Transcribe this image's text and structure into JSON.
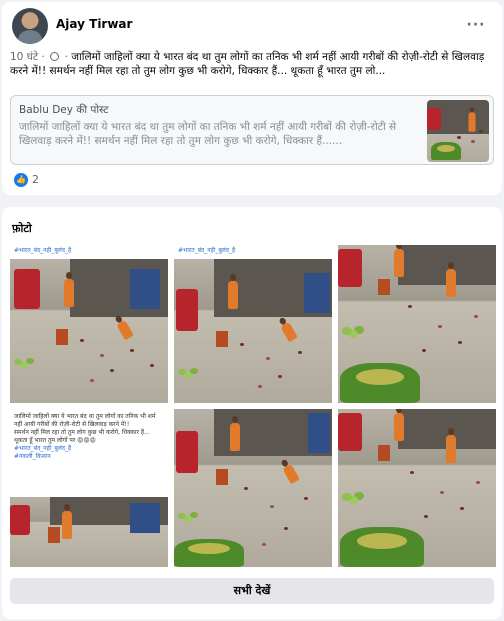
{
  "post": {
    "author": "Ajay Tirwar",
    "more_icon": "more-horizontal-icon",
    "time": "10 घंटे",
    "separator": " · ",
    "text": "जालिमों जाहिलों क्या ये भारत बंद था तुम लोगों का तनिक भी शर्म नहीं आयी गरीबों की रोज़ी-रोटी से खिलवाड़ करने में!! समर्थन नहीं मिल रहा तो तुम लोग कुछ भी करोगे, धिक्कार हैं... थूकता हूँ भारत तुम लो...",
    "shared": {
      "author": "Bablu Dey की पोस्ट",
      "text": "जालिमों जाहिलों क्या ये भारत बंद था तुम लोगों का तनिक भी शर्म नहीं आयी गरीबों की रोज़ी-रोटी से खिलवाड़ करने में!! समर्थन नहीं मिल रहा तो तुम लोग कुछ भी करोगे, धिक्कार हैं......"
    },
    "reactions": {
      "icon": "like-icon",
      "count": "2"
    }
  },
  "photos": {
    "title": "फ़ोटो",
    "see_all": "सभी देखें",
    "caption_top": "#भारत_बंद_नही_बुलंद_है",
    "caption": {
      "line1": "जालिमों जाहिलों क्या ये भारत बंद था तुम लोगों का तनिक भी शर्म नहीं आयी गरीबों की रोज़ी-रोटी से खिलवाड़ करने में!!",
      "line2": "समर्थन नहीं मिल रहा तो तुम लोग कुछ भी करोगे, धिक्कार हैं...",
      "line3": "थूकता हूँ भारत तुम लोगों पर 😡😡😡",
      "tag1": "#भारत_बंद_नही_बुलंद_है",
      "tag2": "#नकली_किसान"
    }
  }
}
